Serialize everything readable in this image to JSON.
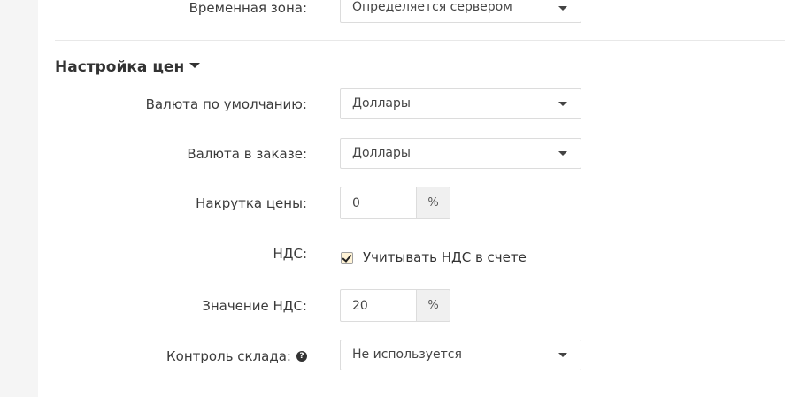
{
  "timezone": {
    "label": "Временная зона:",
    "value": "Определяется сервером"
  },
  "section": {
    "title": "Настройка цен"
  },
  "default_currency": {
    "label": "Валюта по умолчанию:",
    "value": "Доллары"
  },
  "order_currency": {
    "label": "Валюта в заказе:",
    "value": "Доллары"
  },
  "markup": {
    "label": "Накрутка цены:",
    "value": "0",
    "unit": "%"
  },
  "vat": {
    "label": "НДС:",
    "checkbox_label": "Учитывать НДС в счете",
    "checked": true
  },
  "vat_value": {
    "label": "Значение НДС:",
    "value": "20",
    "unit": "%"
  },
  "stock_control": {
    "label": "Контроль склада:",
    "value": "Не используется",
    "help_icon_glyph": "?"
  }
}
